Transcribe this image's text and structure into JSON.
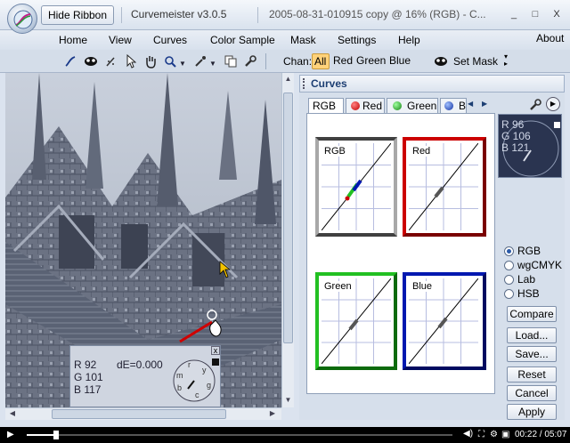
{
  "window": {
    "hide_ribbon": "Hide Ribbon",
    "app_title": "Curvemeister v3.0.5",
    "doc_title": "2005-08-31-010915 copy @ 16% (RGB) - C...",
    "minimize": "_",
    "maximize": "□",
    "close": "X"
  },
  "menu": [
    "Home",
    "View",
    "Curves",
    "Color Sample",
    "Mask",
    "Settings",
    "Help"
  ],
  "about": "About",
  "toolbar": {
    "chan_label": "Chan:",
    "channels": [
      "All",
      "Red",
      "Green",
      "Blue"
    ],
    "selected_channel": "All",
    "set_mask": "Set Mask"
  },
  "image_info": {
    "r": "R  92",
    "de": "dE=0.000",
    "g": "G  101",
    "b": "B  117",
    "close": "x"
  },
  "curves": {
    "title": "Curves",
    "tabs": [
      "RGB",
      "Red",
      "Green",
      "B"
    ],
    "graphs": [
      "RGB",
      "Red",
      "Green",
      "Blue"
    ],
    "readout": {
      "r": "R   96",
      "g": "G  106",
      "b": "B  121"
    },
    "modes": [
      "RGB",
      "wgCMYK",
      "Lab",
      "HSB"
    ],
    "selected_mode": "RGB",
    "buttons": [
      "Compare",
      "Load...",
      "Save...",
      "Reset",
      "Cancel",
      "Apply"
    ]
  },
  "player": {
    "time": "00:22 / 05:07",
    "progress": 0.07
  },
  "colors": {
    "red": "#cc0000",
    "green": "#22c022",
    "blue": "#0018b0",
    "accent": "#1d3f73"
  }
}
